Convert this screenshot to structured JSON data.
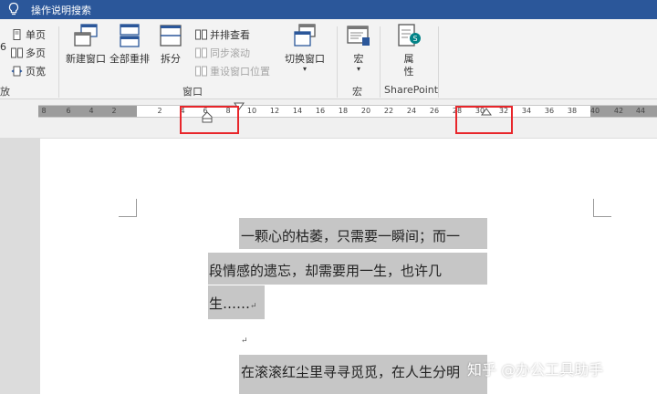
{
  "title_bar": {
    "tell_me": "操作说明搜索"
  },
  "ribbon": {
    "view_group": {
      "one_page": "单页",
      "multiple_pages": "多页",
      "page_width": "页宽",
      "group_label": "放",
      "cut_left": "6"
    },
    "window_group": {
      "new_window": "新建窗口",
      "arrange_all": "全部重排",
      "split": "拆分",
      "view_side_by_side": "并排查看",
      "sync_scrolling": "同步滚动",
      "reset_window_position": "重设窗口位置",
      "switch_windows": "切换窗口",
      "group_label": "窗口"
    },
    "macros_group": {
      "macros": "宏",
      "group_label": "宏"
    },
    "sharepoint_group": {
      "properties_line1": "属",
      "properties_line2": "性",
      "group_label": "SharePoint"
    }
  },
  "ruler": {
    "ticks": [
      "8",
      "6",
      "4",
      "2",
      "2",
      "4",
      "6",
      "8",
      "10",
      "12",
      "14",
      "16",
      "18",
      "20",
      "22",
      "24",
      "26",
      "28",
      "30",
      "32",
      "34",
      "36",
      "38",
      "40",
      "42",
      "44"
    ]
  },
  "document": {
    "lines": [
      "一颗心的枯萎，只需要一瞬间；而一",
      "段情感的遗忘，却需要用一生，也许几",
      "生……",
      "",
      "在滚滚红尘里寻寻觅觅，在人生分明"
    ],
    "paragraph_mark": "↵"
  },
  "watermark": "知乎 @办公工具助手",
  "colors": {
    "title_bar": "#2b579a",
    "ribbon_bg": "#f3f3f3",
    "selection": "#c6c6c6",
    "highlight_box": "#e8262b"
  }
}
